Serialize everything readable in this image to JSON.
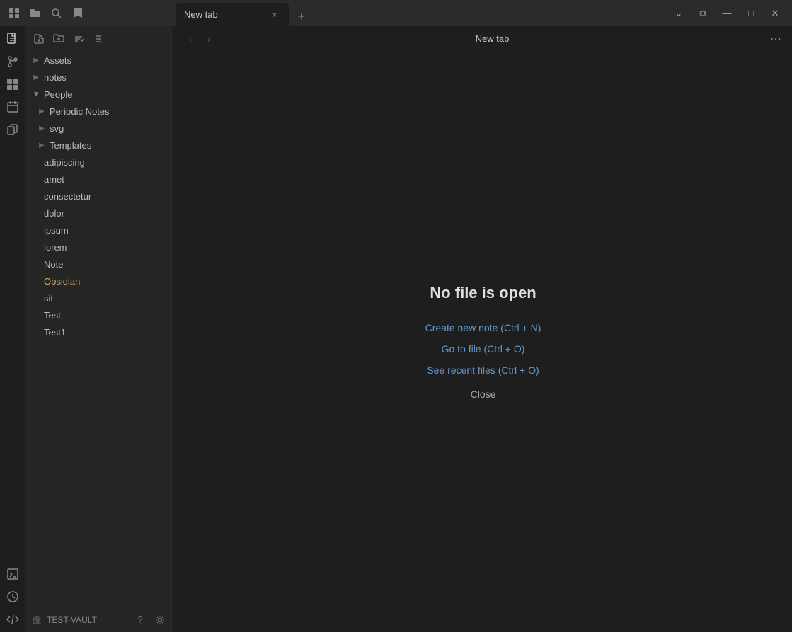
{
  "titlebar": {
    "icons": [
      "grid-icon",
      "folder-icon",
      "search-icon",
      "bookmark-icon"
    ],
    "tab": {
      "label": "New tab",
      "close_label": "×"
    },
    "new_tab_label": "+",
    "window_controls": {
      "tab_list": "⌄",
      "split": "⧉",
      "minimize": "—",
      "maximize": "□",
      "close": "✕"
    }
  },
  "activity_bar": {
    "icons": [
      {
        "name": "files-icon",
        "glyph": "☰",
        "active": true
      },
      {
        "name": "git-icon",
        "glyph": "⑂"
      },
      {
        "name": "grid-plugins-icon",
        "glyph": "⊞"
      },
      {
        "name": "calendar-icon",
        "glyph": "📅"
      },
      {
        "name": "copy-icon",
        "glyph": "⧉"
      },
      {
        "name": "terminal-icon",
        "glyph": ">_"
      },
      {
        "name": "clock-icon",
        "glyph": "◷"
      },
      {
        "name": "code-icon",
        "glyph": "</>"
      }
    ]
  },
  "explorer": {
    "toolbar": {
      "new_note": "✎",
      "new_folder": "🗁",
      "sort": "⇅",
      "collapse": "✕"
    },
    "tree": [
      {
        "type": "folder",
        "label": "Assets",
        "open": false
      },
      {
        "type": "folder",
        "label": "notes",
        "open": false
      },
      {
        "type": "folder",
        "label": "People",
        "open": true
      },
      {
        "type": "folder",
        "label": "Periodic Notes",
        "open": false
      },
      {
        "type": "folder",
        "label": "svg",
        "open": false
      },
      {
        "type": "folder",
        "label": "Templates",
        "open": false
      },
      {
        "type": "file",
        "label": "adipiscing"
      },
      {
        "type": "file",
        "label": "amet"
      },
      {
        "type": "file",
        "label": "consectetur"
      },
      {
        "type": "file",
        "label": "dolor"
      },
      {
        "type": "file",
        "label": "ipsum"
      },
      {
        "type": "file",
        "label": "lorem"
      },
      {
        "type": "file",
        "label": "Note"
      },
      {
        "type": "file",
        "label": "Obsidian"
      },
      {
        "type": "file",
        "label": "sit"
      },
      {
        "type": "file",
        "label": "Test"
      },
      {
        "type": "file",
        "label": "Test1"
      }
    ],
    "footer": {
      "vault_name": "TEST-VAULT",
      "help_label": "?",
      "settings_label": "⚙"
    }
  },
  "content": {
    "header": {
      "back_label": "‹",
      "forward_label": "›",
      "title": "New tab",
      "menu_label": "⋯"
    },
    "body": {
      "no_file_title": "No file is open",
      "links": [
        {
          "label": "Create new note (Ctrl + N)"
        },
        {
          "label": "Go to file (Ctrl + O)"
        },
        {
          "label": "See recent files (Ctrl + O)"
        }
      ],
      "close_label": "Close"
    }
  }
}
